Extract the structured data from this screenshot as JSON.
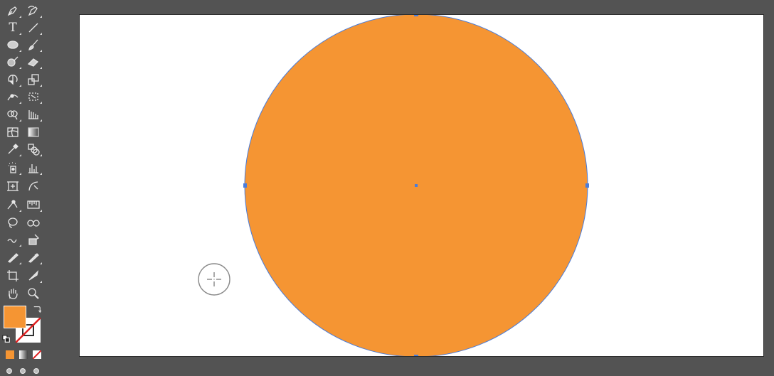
{
  "app": {
    "colors": {
      "workspace_bg": "#535353",
      "artboard_bg": "#ffffff",
      "shape_fill": "#f59533",
      "selection": "#4a7ddb",
      "stroke_swatch": "none"
    }
  },
  "toolbar": {
    "tools": [
      {
        "icon": "pen-tool-icon"
      },
      {
        "icon": "curvature-tool-icon"
      },
      {
        "icon": "type-tool-icon",
        "glyph": "T"
      },
      {
        "icon": "line-segment-tool-icon"
      },
      {
        "icon": "ellipse-tool-icon"
      },
      {
        "icon": "paintbrush-tool-icon"
      },
      {
        "icon": "shaper-tool-icon"
      },
      {
        "icon": "eraser-tool-icon"
      },
      {
        "icon": "rotate-tool-icon"
      },
      {
        "icon": "scale-tool-icon"
      },
      {
        "icon": "width-tool-icon"
      },
      {
        "icon": "free-transform-tool-icon"
      },
      {
        "icon": "shape-builder-tool-icon"
      },
      {
        "icon": "perspective-grid-tool-icon"
      },
      {
        "icon": "mesh-tool-icon"
      },
      {
        "icon": "gradient-tool-icon"
      },
      {
        "icon": "eyedropper-tool-icon"
      },
      {
        "icon": "blend-tool-icon"
      },
      {
        "icon": "symbol-sprayer-tool-icon"
      },
      {
        "icon": "column-graph-tool-icon"
      },
      {
        "icon": "artboard-tool-icon"
      },
      {
        "icon": "slice-tool-icon"
      },
      {
        "icon": "puppet-warp-tool-icon"
      },
      {
        "icon": "measure-tool-icon"
      },
      {
        "icon": "lasso-tool-icon"
      },
      {
        "icon": "glasses-view-tool-icon"
      },
      {
        "icon": "smooth-tool-icon"
      },
      {
        "icon": "live-paint-tool-icon"
      },
      {
        "icon": "pencil-tool-icon"
      },
      {
        "icon": "blob-brush-tool-icon"
      },
      {
        "icon": "crop-artboard-tool-icon"
      },
      {
        "icon": "knife-tool-icon"
      },
      {
        "icon": "hand-tool-icon"
      },
      {
        "icon": "zoom-tool-icon"
      }
    ],
    "fill_color": "#f59533",
    "swap_icon": "swap-fill-stroke-icon",
    "default_icon": "default-fill-stroke-icon",
    "modes": [
      "color-mode-icon",
      "gradient-mode-icon",
      "none-mode-icon"
    ],
    "draw_modes": [
      "draw-normal-icon",
      "draw-behind-icon",
      "draw-inside-icon"
    ]
  },
  "canvas": {
    "shape": "ellipse",
    "selected": true,
    "cursor": "ellipse-tool-cursor-icon"
  }
}
